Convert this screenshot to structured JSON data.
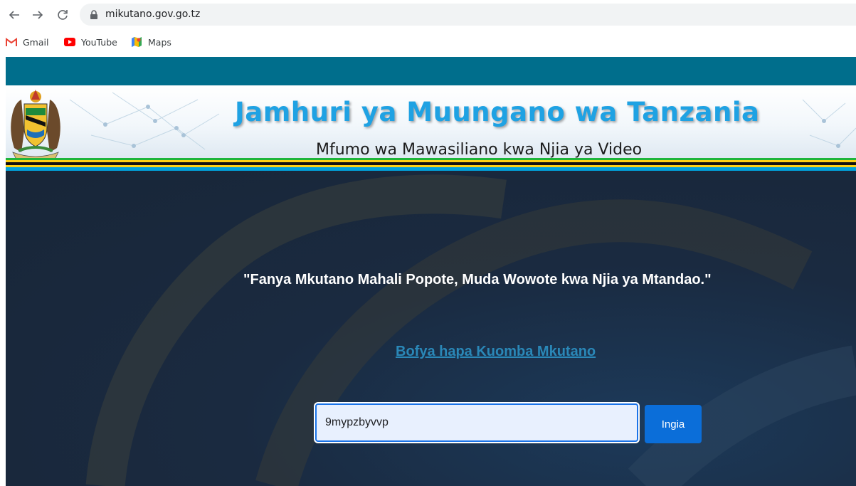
{
  "browser": {
    "url": "mikutano.gov.go.tz",
    "bookmarks": [
      {
        "label": "Gmail",
        "icon": "gmail-icon"
      },
      {
        "label": "YouTube",
        "icon": "youtube-icon"
      },
      {
        "label": "Maps",
        "icon": "maps-icon"
      }
    ]
  },
  "banner": {
    "title": "Jamhuri ya Muungano wa Tanzania",
    "subtitle": "Mfumo wa Mawasiliano kwa Njia ya Video"
  },
  "main": {
    "tagline": "\"Fanya Mkutano Mahali Popote, Muda Wowote kwa Njia ya Mtandao.\"",
    "request_link": "Bofya hapa Kuomba Mkutano",
    "meeting_input_value": "9mypzbyvvp",
    "join_button": "Ingia"
  },
  "colors": {
    "topbar": "#006e8c",
    "hero_background": "#1c2e46",
    "title_blue": "#1fa2e3",
    "link": "#2a88b8",
    "button": "#0b6ed9"
  }
}
